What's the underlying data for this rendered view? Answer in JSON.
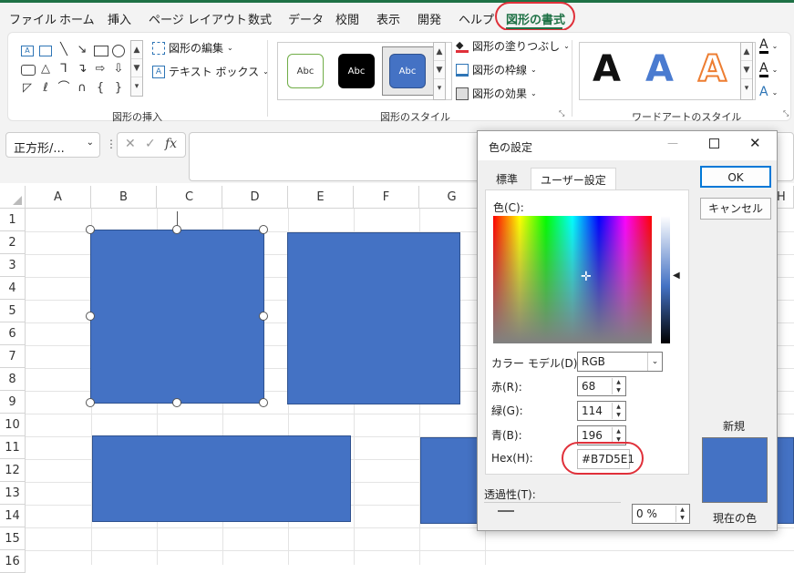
{
  "menu": {
    "tabs": [
      "ファイル",
      "ホーム",
      "挿入",
      "ページ レイアウト",
      "数式",
      "データ",
      "校閲",
      "表示",
      "開発",
      "ヘルプ",
      "図形の書式"
    ]
  },
  "ribbon": {
    "edit_shape": "図形の編集",
    "text_box": "テキスト ボックス",
    "group_insert": "図形の挿入",
    "style_sample": "Abc",
    "group_styles": "図形のスタイル",
    "fill": "図形の塗りつぶし",
    "outline": "図形の枠線",
    "effects": "図形の効果",
    "wordart_letter": "A",
    "group_wordart": "ワードアートのスタイル"
  },
  "formula_bar": {
    "name_box": "正方形/...",
    "fx": "fx"
  },
  "sheet": {
    "columns": [
      "A",
      "B",
      "C",
      "D",
      "E",
      "F",
      "G",
      "H"
    ],
    "rows": [
      "1",
      "2",
      "3",
      "4",
      "5",
      "6",
      "7",
      "8",
      "9",
      "10",
      "11",
      "12",
      "13",
      "14",
      "15",
      "16"
    ]
  },
  "dialog": {
    "title": "色の設定",
    "tab_standard": "標準",
    "tab_custom": "ユーザー設定",
    "color_label": "色(C):",
    "model_label": "カラー モデル(D):",
    "model_value": "RGB",
    "red_label": "赤(R):",
    "red_value": "68",
    "green_label": "緑(G):",
    "green_value": "114",
    "blue_label": "青(B):",
    "blue_value": "196",
    "hex_label": "Hex(H):",
    "hex_value": "#B7D5E1",
    "transparency_label": "透過性(T):",
    "transparency_value": "0 %",
    "ok": "OK",
    "cancel": "キャンセル",
    "new_label": "新規",
    "current_label": "現在の色"
  },
  "colors": {
    "shape_fill": "#4472c4",
    "accent": "#1e7145",
    "highlight_circle": "#e0303a"
  }
}
